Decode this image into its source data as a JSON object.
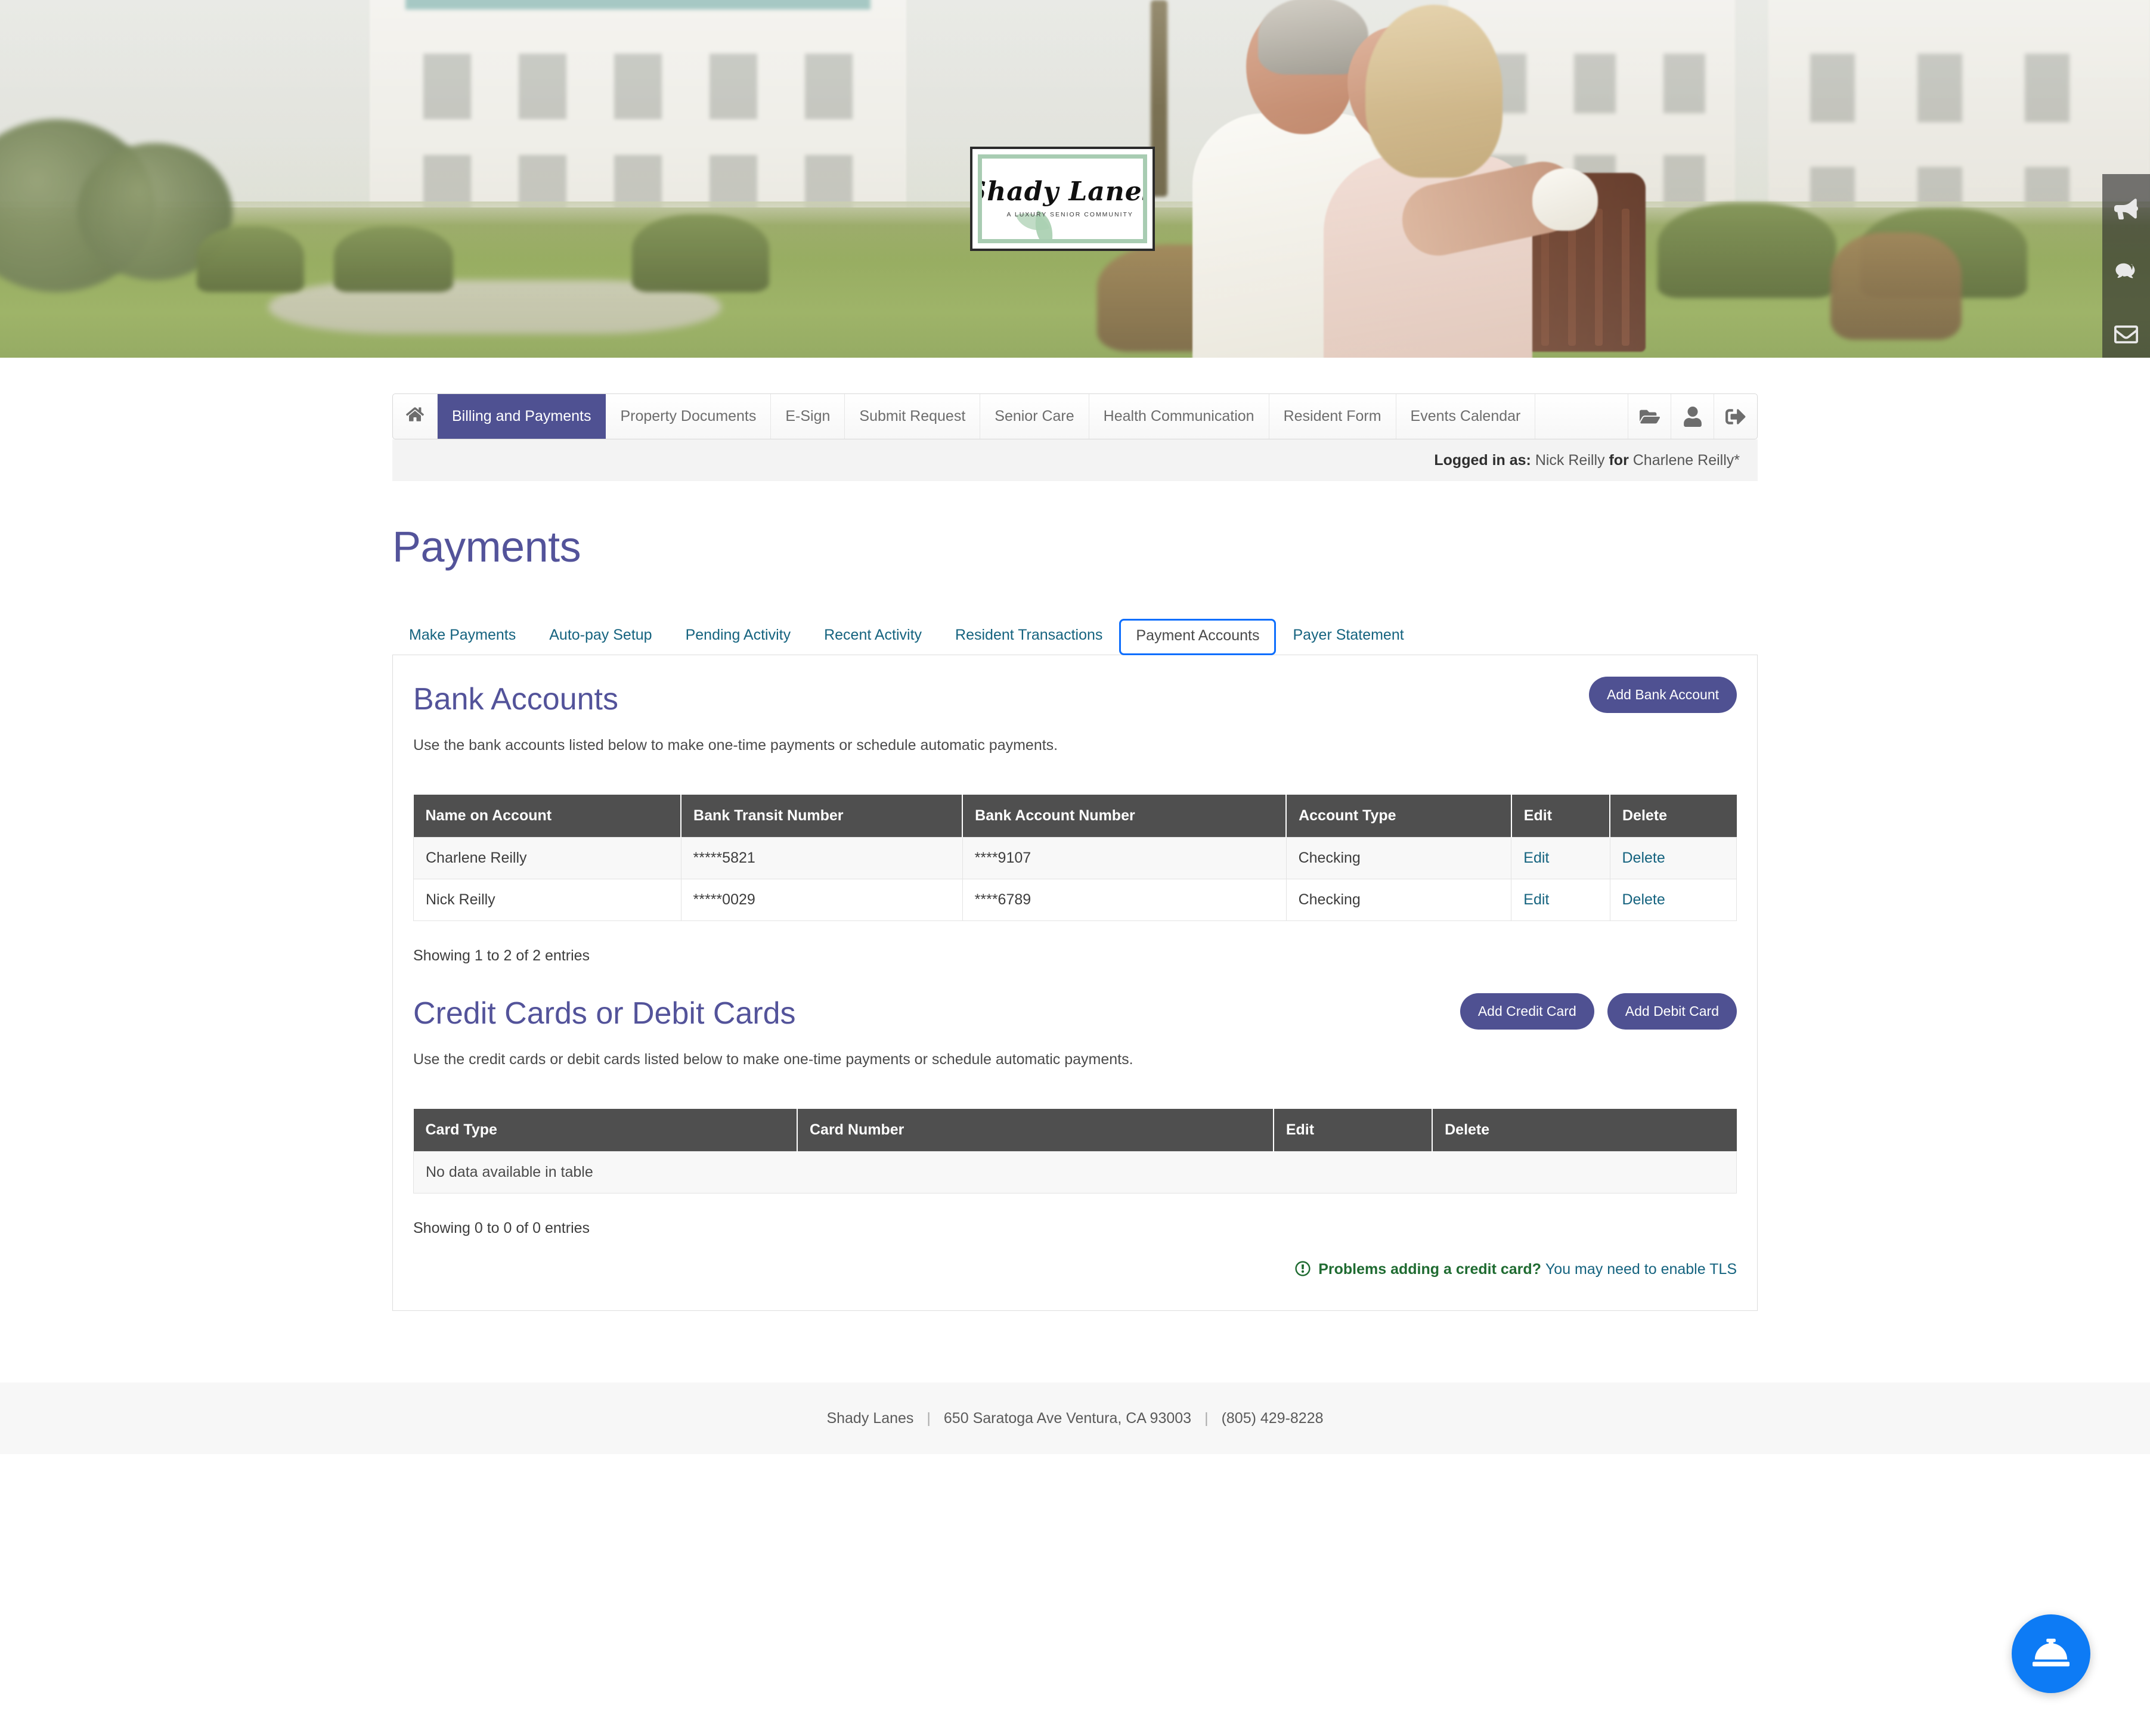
{
  "hero": {
    "logo": {
      "name": "Shady Lanes",
      "tagline": "A LUXURY SENIOR COMMUNITY"
    },
    "rail_icons": [
      "bullhorn-icon",
      "comments-icon",
      "envelope-icon"
    ]
  },
  "topnav": {
    "home_icon": "home-icon",
    "items": [
      {
        "label": "Billing and Payments",
        "active": true
      },
      {
        "label": "Property Documents",
        "active": false
      },
      {
        "label": "E-Sign",
        "active": false
      },
      {
        "label": "Submit Request",
        "active": false
      },
      {
        "label": "Senior Care",
        "active": false
      },
      {
        "label": "Health Communication",
        "active": false
      },
      {
        "label": "Resident Form",
        "active": false
      },
      {
        "label": "Events Calendar",
        "active": false
      }
    ],
    "action_icons": [
      "folder-open-icon",
      "user-icon",
      "sign-out-icon"
    ]
  },
  "loginbar": {
    "logged_in_as_label": "Logged in as:",
    "user": "Nick Reilly",
    "for_label": "for",
    "resident": "Charlene Reilly*"
  },
  "page": {
    "title": "Payments"
  },
  "subtabs": [
    {
      "label": "Make Payments",
      "active": false
    },
    {
      "label": "Auto-pay Setup",
      "active": false
    },
    {
      "label": "Pending Activity",
      "active": false
    },
    {
      "label": "Recent Activity",
      "active": false
    },
    {
      "label": "Resident Transactions",
      "active": false
    },
    {
      "label": "Payment Accounts",
      "active": true
    },
    {
      "label": "Payer Statement",
      "active": false
    }
  ],
  "bank_section": {
    "title": "Bank Accounts",
    "description": "Use the bank accounts listed below to make one-time payments or schedule automatic payments.",
    "add_button": "Add Bank Account",
    "columns": [
      "Name on Account",
      "Bank Transit Number",
      "Bank Account Number",
      "Account Type",
      "Edit",
      "Delete"
    ],
    "rows": [
      {
        "name": "Charlene Reilly",
        "transit": "*****5821",
        "account": "****9107",
        "type": "Checking",
        "edit": "Edit",
        "delete": "Delete"
      },
      {
        "name": "Nick Reilly",
        "transit": "*****0029",
        "account": "****6789",
        "type": "Checking",
        "edit": "Edit",
        "delete": "Delete"
      }
    ],
    "showing": "Showing 1 to 2 of 2 entries"
  },
  "card_section": {
    "title": "Credit Cards or Debit Cards",
    "description": "Use the credit cards or debit cards listed below to make one-time payments or schedule automatic payments.",
    "add_credit_button": "Add Credit Card",
    "add_debit_button": "Add Debit Card",
    "columns": [
      "Card Type",
      "Card Number",
      "Edit",
      "Delete"
    ],
    "empty_message": "No data available in table",
    "showing": "Showing 0 to 0 of 0 entries",
    "tls_warning": "Problems adding a credit card?",
    "tls_link": "You may need to enable TLS"
  },
  "footer": {
    "name": "Shady Lanes",
    "address": "650 Saratoga Ave  Ventura, CA 93003",
    "phone": "(805) 429-8228",
    "separator": "|"
  },
  "fab": {
    "icon": "concierge-bell-icon"
  },
  "colors": {
    "brand_purple": "#4f5192",
    "heading_purple": "#53539a",
    "link_teal": "#15637f",
    "table_header": "#4f4f4f",
    "focus_blue": "#0d6efd",
    "warn_green": "#1f6b31",
    "fab_blue": "#0d7bf5"
  }
}
